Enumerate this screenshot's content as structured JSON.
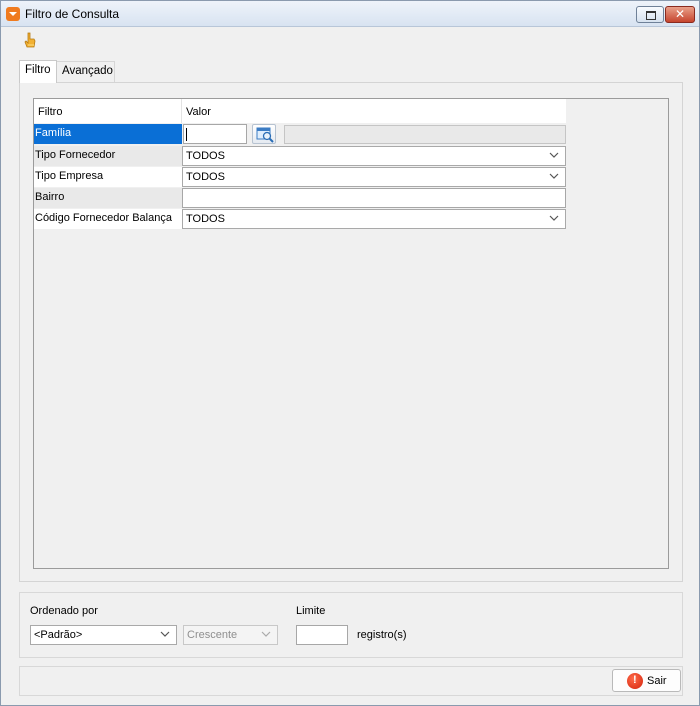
{
  "window": {
    "title": "Filtro de Consulta"
  },
  "tabs": [
    {
      "label": "Filtro",
      "active": true
    },
    {
      "label": "Avançado",
      "active": false
    }
  ],
  "grid": {
    "headers": {
      "filter": "Filtro",
      "value": "Valor"
    },
    "rows": [
      {
        "label": "Família",
        "type": "lookup",
        "value": "",
        "selected": true
      },
      {
        "label": "Tipo Fornecedor",
        "type": "combo",
        "value": "TODOS"
      },
      {
        "label": "Tipo Empresa",
        "type": "combo",
        "value": "TODOS"
      },
      {
        "label": "Bairro",
        "type": "text",
        "value": ""
      },
      {
        "label": "Código Fornecedor Balança",
        "type": "combo",
        "value": "TODOS"
      }
    ]
  },
  "ordering": {
    "label": "Ordenado por",
    "field_value": "<Padrão>",
    "direction_value": "Crescente",
    "direction_enabled": false
  },
  "limit": {
    "label": "Limite",
    "value": "",
    "unit": "registro(s)"
  },
  "footer": {
    "exit_label": "Sair"
  },
  "colors": {
    "selection": "#0a6fd6",
    "exit_icon": "#d4230c",
    "app_icon": "#f07b1f"
  },
  "icons": {
    "app": "dropdown-app-icon",
    "clear_filter": "hand-pointer-icon",
    "lookup": "search-window-icon",
    "exit": "stop-icon"
  }
}
